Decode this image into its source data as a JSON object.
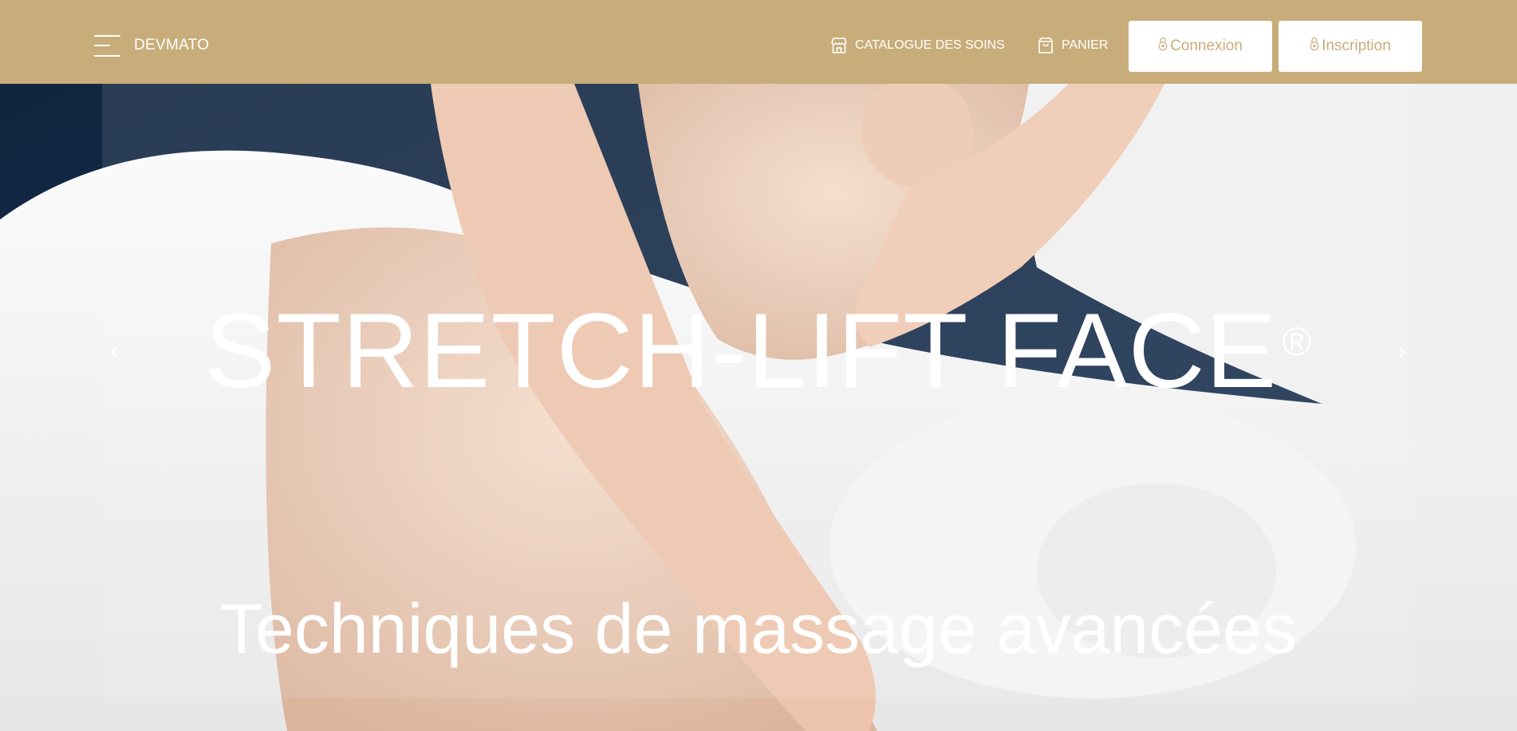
{
  "brand": {
    "name": "DEVMATO"
  },
  "nav": {
    "catalogue_label": "CATALOGUE DES SOINS",
    "cart_label": "PANIER",
    "login_label": "Connexion",
    "signup_label": "Inscription"
  },
  "hero": {
    "title": "STRETCH-LIFT FACE",
    "title_mark": "®",
    "subtitle": "Techniques de massage avancées",
    "prev_arrow": "‹",
    "next_arrow": "›"
  },
  "icons": {
    "menu": "hamburger-menu-icon",
    "catalogue": "store-icon",
    "cart": "shopping-bag-icon",
    "login": "lock-icon",
    "signup": "lock-icon"
  },
  "colors": {
    "navbar": "#c8ad7a",
    "button_bg": "#ffffff",
    "button_text": "#c8ad7a",
    "hero_text": "#ffffff"
  }
}
